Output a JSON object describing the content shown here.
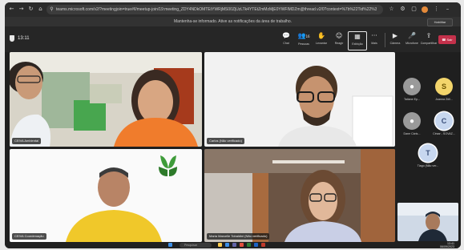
{
  "browser": {
    "url": "teams.microsoft.com/v2/?meetingjoin=true#/l/meetup-join/19:meeting_ZDY4NDkOMTEtYWRjMS00ZjUzLTk4YTEtZmMzMjE0YWFlMDZm@thread.v2/0?context=%7b%22Tid%22%3a%",
    "icons": [
      "back-icon",
      "forward-icon",
      "reload-icon",
      "site-info-icon",
      "star-icon",
      "extensions-icon",
      "tabs-icon",
      "profile-icon",
      "menu-icon"
    ]
  },
  "notification": {
    "text": "Mantenha-se informado. Ative as notificações da área de trabalho.",
    "button": "Habilitar"
  },
  "toolbar": {
    "timer": "13:11",
    "buttons": [
      {
        "label": "Chat",
        "icon": "chat-icon"
      },
      {
        "label": "Pessoas",
        "icon": "people-icon",
        "badge": "16"
      },
      {
        "label": "Levantar",
        "icon": "raise-hand-icon"
      },
      {
        "label": "Reagir",
        "icon": "react-icon"
      },
      {
        "label": "Exibição",
        "icon": "view-icon"
      },
      {
        "label": "Mais",
        "icon": "more-icon"
      },
      {
        "label": "Câmera",
        "icon": "camera-icon"
      },
      {
        "label": "Microfone",
        "icon": "mic-icon"
      },
      {
        "label": "Compartilhar",
        "icon": "share-icon"
      }
    ],
    "leave": "Sair"
  },
  "tiles": [
    {
      "name": "CEIVA Ambiental"
    },
    {
      "name": "Carlos (Não verificado)"
    },
    {
      "name": "CEIVA Coordenação"
    },
    {
      "name": "Maria Marcelle Tobaldini (Não verificado)"
    }
  ],
  "roster": [
    {
      "name": "Tatiane Ep...",
      "initial": "",
      "color": "#9a9a9a"
    },
    {
      "name": "Joanna Zöll...",
      "initial": "S",
      "color": "#f3d56b"
    },
    {
      "name": "Dane Cáris...",
      "initial": "",
      "color": "#9a9a9a"
    },
    {
      "name": "César - SOVAZ...",
      "initial": "C",
      "color": "#c7d7ef"
    },
    {
      "name": "Tiago (Não ver...",
      "initial": "T",
      "color": "#c7d7ef"
    }
  ],
  "taskbar": {
    "search": "Pesquisar",
    "time": "13:41",
    "date": "06/09/2023"
  }
}
